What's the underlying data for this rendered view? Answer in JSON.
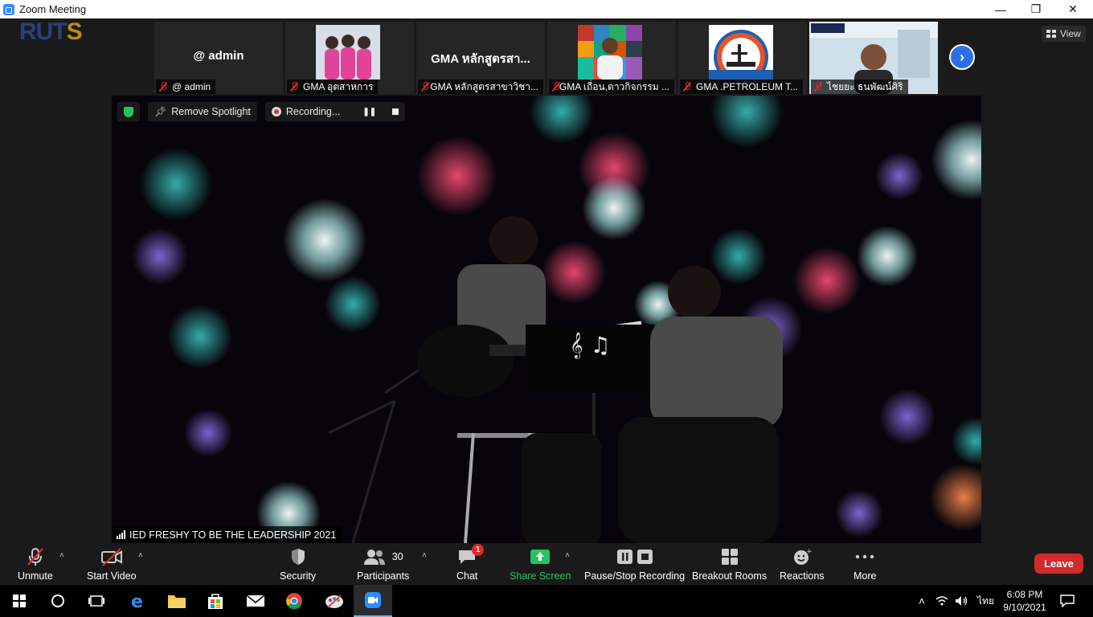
{
  "window": {
    "title": "Zoom Meeting",
    "minimize": "—",
    "restore": "❐",
    "close": "✕"
  },
  "logo": {
    "text_main": "RUT",
    "text_accent": "S"
  },
  "thumbnails": [
    {
      "big_text": "@ admin",
      "label": "@ admin",
      "has_video": false
    },
    {
      "big_text": "",
      "label": "GMA อุตสาหการ",
      "has_video": true
    },
    {
      "big_text": "GMA หลักสูตรสา...",
      "label": "GMA หลักสูตรสาขาวิชา...",
      "has_video": false
    },
    {
      "big_text": "",
      "label": "GMA เถื่อน,ดาวกิจกรรม ...",
      "has_video": true
    },
    {
      "big_text": "",
      "label": "GMA .PETROLEUM T...",
      "has_video": true
    },
    {
      "big_text": "",
      "label": "ไชยยะ ธนพัฒน์ศิริ",
      "has_video": true
    }
  ],
  "view_button": "View",
  "spotlight": {
    "remove_label": "Remove Spotlight",
    "recording_label": "Recording..."
  },
  "video_name": "IED FRESHY TO BE THE LEADERSHIP 2021",
  "toolbar": {
    "unmute": "Unmute",
    "start_video": "Start Video",
    "security": "Security",
    "participants": "Participants",
    "participants_count": "30",
    "chat": "Chat",
    "chat_badge": "1",
    "share_screen": "Share Screen",
    "pause_stop_recording": "Pause/Stop Recording",
    "breakout_rooms": "Breakout Rooms",
    "reactions": "Reactions",
    "more": "More",
    "leave": "Leave"
  },
  "taskbar": {
    "lang": "ไทย",
    "time": "6:08 PM",
    "date": "9/10/2021"
  },
  "colors": {
    "accent_blue": "#2d8cff",
    "share_green": "#23c45e",
    "leave_red": "#d12a2a",
    "mute_red": "#e02828"
  }
}
